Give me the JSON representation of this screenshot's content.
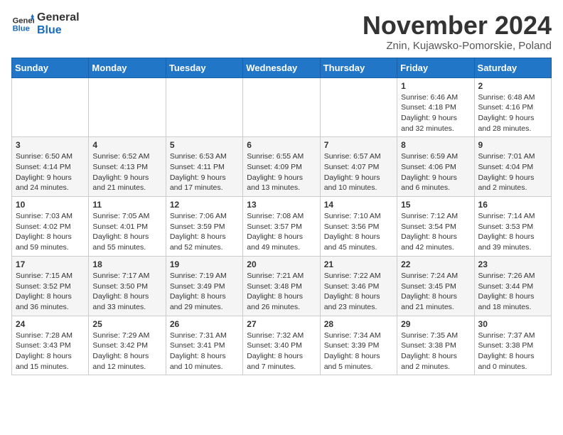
{
  "logo": {
    "text_general": "General",
    "text_blue": "Blue"
  },
  "title": "November 2024",
  "subtitle": "Znin, Kujawsko-Pomorskie, Poland",
  "days_of_week": [
    "Sunday",
    "Monday",
    "Tuesday",
    "Wednesday",
    "Thursday",
    "Friday",
    "Saturday"
  ],
  "weeks": [
    [
      {
        "day": "",
        "info": ""
      },
      {
        "day": "",
        "info": ""
      },
      {
        "day": "",
        "info": ""
      },
      {
        "day": "",
        "info": ""
      },
      {
        "day": "",
        "info": ""
      },
      {
        "day": "1",
        "info": "Sunrise: 6:46 AM\nSunset: 4:18 PM\nDaylight: 9 hours and 32 minutes."
      },
      {
        "day": "2",
        "info": "Sunrise: 6:48 AM\nSunset: 4:16 PM\nDaylight: 9 hours and 28 minutes."
      }
    ],
    [
      {
        "day": "3",
        "info": "Sunrise: 6:50 AM\nSunset: 4:14 PM\nDaylight: 9 hours and 24 minutes."
      },
      {
        "day": "4",
        "info": "Sunrise: 6:52 AM\nSunset: 4:13 PM\nDaylight: 9 hours and 21 minutes."
      },
      {
        "day": "5",
        "info": "Sunrise: 6:53 AM\nSunset: 4:11 PM\nDaylight: 9 hours and 17 minutes."
      },
      {
        "day": "6",
        "info": "Sunrise: 6:55 AM\nSunset: 4:09 PM\nDaylight: 9 hours and 13 minutes."
      },
      {
        "day": "7",
        "info": "Sunrise: 6:57 AM\nSunset: 4:07 PM\nDaylight: 9 hours and 10 minutes."
      },
      {
        "day": "8",
        "info": "Sunrise: 6:59 AM\nSunset: 4:06 PM\nDaylight: 9 hours and 6 minutes."
      },
      {
        "day": "9",
        "info": "Sunrise: 7:01 AM\nSunset: 4:04 PM\nDaylight: 9 hours and 2 minutes."
      }
    ],
    [
      {
        "day": "10",
        "info": "Sunrise: 7:03 AM\nSunset: 4:02 PM\nDaylight: 8 hours and 59 minutes."
      },
      {
        "day": "11",
        "info": "Sunrise: 7:05 AM\nSunset: 4:01 PM\nDaylight: 8 hours and 55 minutes."
      },
      {
        "day": "12",
        "info": "Sunrise: 7:06 AM\nSunset: 3:59 PM\nDaylight: 8 hours and 52 minutes."
      },
      {
        "day": "13",
        "info": "Sunrise: 7:08 AM\nSunset: 3:57 PM\nDaylight: 8 hours and 49 minutes."
      },
      {
        "day": "14",
        "info": "Sunrise: 7:10 AM\nSunset: 3:56 PM\nDaylight: 8 hours and 45 minutes."
      },
      {
        "day": "15",
        "info": "Sunrise: 7:12 AM\nSunset: 3:54 PM\nDaylight: 8 hours and 42 minutes."
      },
      {
        "day": "16",
        "info": "Sunrise: 7:14 AM\nSunset: 3:53 PM\nDaylight: 8 hours and 39 minutes."
      }
    ],
    [
      {
        "day": "17",
        "info": "Sunrise: 7:15 AM\nSunset: 3:52 PM\nDaylight: 8 hours and 36 minutes."
      },
      {
        "day": "18",
        "info": "Sunrise: 7:17 AM\nSunset: 3:50 PM\nDaylight: 8 hours and 33 minutes."
      },
      {
        "day": "19",
        "info": "Sunrise: 7:19 AM\nSunset: 3:49 PM\nDaylight: 8 hours and 29 minutes."
      },
      {
        "day": "20",
        "info": "Sunrise: 7:21 AM\nSunset: 3:48 PM\nDaylight: 8 hours and 26 minutes."
      },
      {
        "day": "21",
        "info": "Sunrise: 7:22 AM\nSunset: 3:46 PM\nDaylight: 8 hours and 23 minutes."
      },
      {
        "day": "22",
        "info": "Sunrise: 7:24 AM\nSunset: 3:45 PM\nDaylight: 8 hours and 21 minutes."
      },
      {
        "day": "23",
        "info": "Sunrise: 7:26 AM\nSunset: 3:44 PM\nDaylight: 8 hours and 18 minutes."
      }
    ],
    [
      {
        "day": "24",
        "info": "Sunrise: 7:28 AM\nSunset: 3:43 PM\nDaylight: 8 hours and 15 minutes."
      },
      {
        "day": "25",
        "info": "Sunrise: 7:29 AM\nSunset: 3:42 PM\nDaylight: 8 hours and 12 minutes."
      },
      {
        "day": "26",
        "info": "Sunrise: 7:31 AM\nSunset: 3:41 PM\nDaylight: 8 hours and 10 minutes."
      },
      {
        "day": "27",
        "info": "Sunrise: 7:32 AM\nSunset: 3:40 PM\nDaylight: 8 hours and 7 minutes."
      },
      {
        "day": "28",
        "info": "Sunrise: 7:34 AM\nSunset: 3:39 PM\nDaylight: 8 hours and 5 minutes."
      },
      {
        "day": "29",
        "info": "Sunrise: 7:35 AM\nSunset: 3:38 PM\nDaylight: 8 hours and 2 minutes."
      },
      {
        "day": "30",
        "info": "Sunrise: 7:37 AM\nSunset: 3:38 PM\nDaylight: 8 hours and 0 minutes."
      }
    ]
  ]
}
